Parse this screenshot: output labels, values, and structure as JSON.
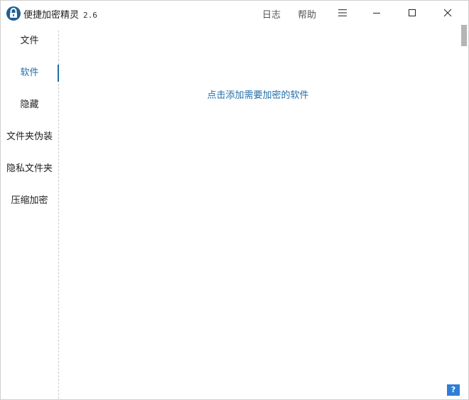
{
  "app": {
    "title": "便捷加密精灵",
    "version": "2.6"
  },
  "toolbar": {
    "log_label": "日志",
    "help_label": "帮助",
    "menu_icon": "hamburger-menu-icon"
  },
  "window_controls": [
    "minimize-icon",
    "maximize-icon",
    "close-icon"
  ],
  "sidebar": {
    "items": [
      {
        "label": "文件"
      },
      {
        "label": "软件"
      },
      {
        "label": "隐藏"
      },
      {
        "label": "文件夹伪装"
      },
      {
        "label": "隐私文件夹"
      },
      {
        "label": "压缩加密"
      }
    ],
    "active_index": 1
  },
  "main": {
    "hint": "点击添加需要加密的软件"
  },
  "help_badge": "?",
  "colors": {
    "accent": "#1f6ea8",
    "help_button": "#2f7fd6",
    "scroll_thumb": "#b5b5b5"
  }
}
